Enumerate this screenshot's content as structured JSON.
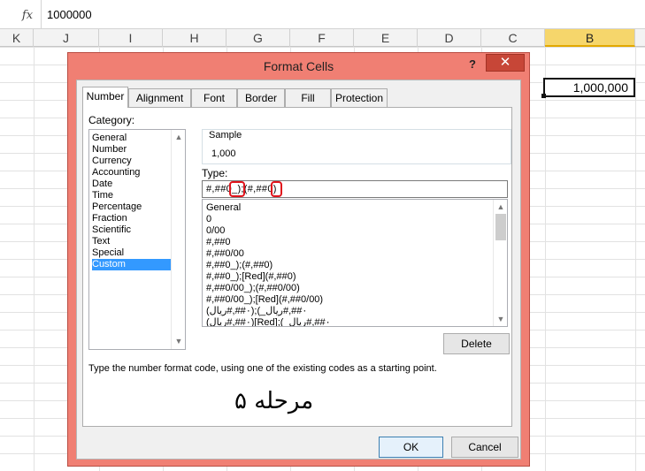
{
  "formula_bar": {
    "fx": "fx",
    "value": "1000000"
  },
  "columns": [
    "K",
    "J",
    "I",
    "H",
    "G",
    "F",
    "E",
    "D",
    "C",
    "B"
  ],
  "active_cell": {
    "column": "B",
    "value": "1,000,000"
  },
  "dialog": {
    "title": "Format Cells",
    "help": "?",
    "close": "✕",
    "tabs": [
      "Number",
      "Alignment",
      "Font",
      "Border",
      "Fill",
      "Protection"
    ],
    "active_tab": "Number",
    "category_label": "Category:",
    "categories": [
      "General",
      "Number",
      "Currency",
      "Accounting",
      "Date",
      "Time",
      "Percentage",
      "Fraction",
      "Scientific",
      "Text",
      "Special",
      "Custom"
    ],
    "selected_category": "Custom",
    "sample_label": "Sample",
    "sample_value": "1,000",
    "type_label": "Type:",
    "type_value": "#,##0_);(#,##0)",
    "type_list": [
      "General",
      "0",
      "0/00",
      "#,##0",
      "#,##0/00",
      "#,##0_);(#,##0)",
      "#,##0_);[Red](#,##0)",
      "#,##0/00_);(#,##0/00)",
      "#,##0/00_);[Red](#,##0/00)",
      "(٠##,#ريال);(_٠##,#ريال",
      "(٠##,#ريال)[Red];(_٠##,#ريال"
    ],
    "delete_button": "Delete",
    "hint": "Type the number format code, using one of the existing codes as a starting point.",
    "annotation": "مرحله ۵",
    "ok_button": "OK",
    "cancel_button": "Cancel"
  },
  "colors": {
    "dialog_frame": "#f07f73",
    "close_button": "#c74637",
    "selection": "#3399ff",
    "highlight_box": "#e0141c",
    "selected_column": "#f6d66b"
  }
}
